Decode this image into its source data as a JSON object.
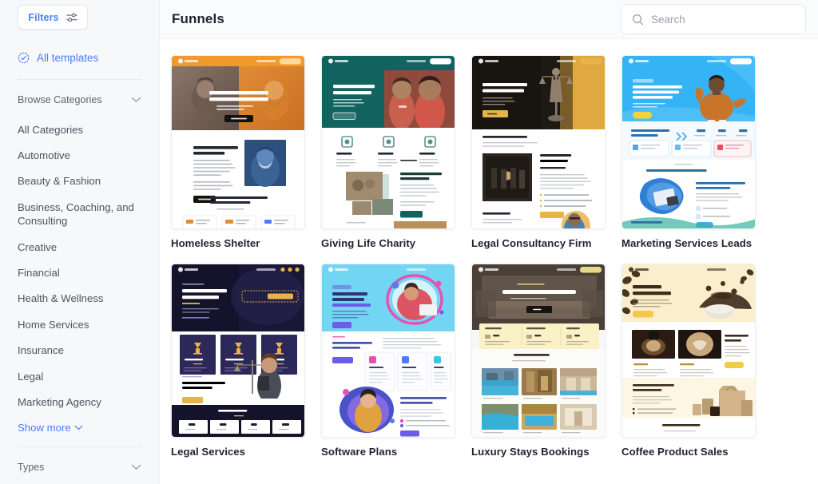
{
  "sidebar": {
    "filters_button": {
      "label": "Filters",
      "icon": "sliders-icon"
    },
    "all_templates": {
      "label": "All templates",
      "icon": "check-circle-icon",
      "color": "#4a7dfb"
    },
    "browse_categories": {
      "label": "Browse Categories",
      "icon": "chevron-down-icon"
    },
    "categories": [
      "All Categories",
      "Automotive",
      "Beauty & Fashion",
      "Business, Coaching, and Consulting",
      "Creative",
      "Financial",
      "Health & Wellness",
      "Home Services",
      "Insurance",
      "Legal",
      "Marketing Agency"
    ],
    "show_more": {
      "label": "Show more",
      "icon": "chevron-down-icon"
    },
    "types": {
      "label": "Types",
      "icon": "chevron-down-icon"
    }
  },
  "header": {
    "title": "Funnels",
    "search": {
      "placeholder": "Search",
      "value": "",
      "icon": "search-icon"
    }
  },
  "templates": [
    {
      "title": "Homeless Shelter",
      "theme": {
        "header": "#f09a2e",
        "hero_left": "#6e5b50",
        "hero_right": "#d97a2b",
        "accent": "#f09a2e",
        "body": "#ffffff"
      },
      "hero_text": "Be someone's answered prayer.",
      "section_text": "With helping hands, we can provide shelter."
    },
    {
      "title": "Giving Life Charity",
      "theme": {
        "header": "#10635e",
        "hero_left": "#10635e",
        "hero_right": "#b85a4a",
        "accent": "#10635e",
        "body": "#ffffff"
      },
      "hero_text": "A small step can change lots of lives.",
      "section_text": "A small step can change lots of lives."
    },
    {
      "title": "Legal Consultancy Firm",
      "theme": {
        "header": "#15110e",
        "hero_left": "#1b1714",
        "hero_right": "#e0a93f",
        "accent": "#e8b44a",
        "body": "#ffffff"
      },
      "hero_text": "A passion for justice. The experience for win.",
      "section_text": "We are your trust and our diligence your case."
    },
    {
      "title": "Marketing Services Leads",
      "theme": {
        "header": "#35b4f5",
        "hero_left": "#35b4f5",
        "hero_right": "#35b4f5",
        "accent": "#f5d23c",
        "body": "#ffffff"
      },
      "hero_text": "Lift Your Business To New Heights With Our Digital Marketing Services",
      "section_text": "The Magic Of Marketing, The Science Of Sales"
    },
    {
      "title": "Legal Services",
      "theme": {
        "header": "#1c1b3a",
        "hero_left": "#14132b",
        "hero_right": "#2a2752",
        "accent": "#e8b44a",
        "body": "#ffffff"
      },
      "hero_text": "A Business Approach to Legal Service",
      "section_text": "A Business Approach to Legal Services"
    },
    {
      "title": "Software Plans",
      "theme": {
        "header": "#72d5f4",
        "hero_left": "#72d5f4",
        "hero_right": "#72d5f4",
        "accent": "#6c5ce7",
        "body": "#ffffff"
      },
      "hero_text": "Listening To You And Providing Software Responses",
      "section_text": "Providing Software Responses"
    },
    {
      "title": "Luxury Stays Bookings",
      "theme": {
        "header": "#3b332c",
        "hero_left": "#4a4038",
        "hero_right": "#6b5d50",
        "accent": "#e8d98a",
        "body": "#f7f7f5"
      },
      "hero_text": "A Luxury Everyone Can Afford",
      "section_text": "Hotels With Freedom Built In"
    },
    {
      "title": "Coffee Product Sales",
      "theme": {
        "header": "#faeecd",
        "hero_left": "#faeecd",
        "hero_right": "#faeecd",
        "accent": "#f3c94a",
        "body": "#ffffff"
      },
      "hero_text": "Live Your Best Coffee Life.",
      "section_text": "Live Your Best Coffee Life."
    }
  ]
}
